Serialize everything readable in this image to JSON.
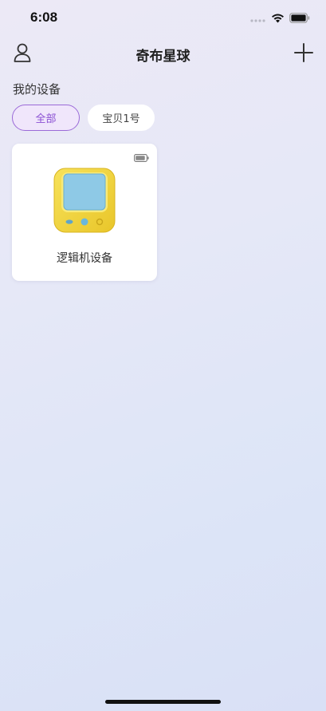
{
  "status_bar": {
    "time": "6:08",
    "icons": [
      "signal-dots-icon",
      "wifi-icon",
      "battery-icon"
    ]
  },
  "header": {
    "title": "奇布星球",
    "left_icon": "user-icon",
    "right_icon": "plus-icon"
  },
  "devices_section": {
    "title": "我的设备",
    "filters": [
      {
        "label": "全部",
        "selected": true
      },
      {
        "label": "宝贝1号",
        "selected": false
      }
    ],
    "items": [
      {
        "name": "逻辑机设备",
        "icon": "battery-icon",
        "image": "yellow-device-image"
      }
    ]
  },
  "colors": {
    "accent": "#8a4fd3",
    "chip_active_bg": "#f0e6fb",
    "device_body": "#f2d63c",
    "device_screen": "#8ec9e6"
  }
}
